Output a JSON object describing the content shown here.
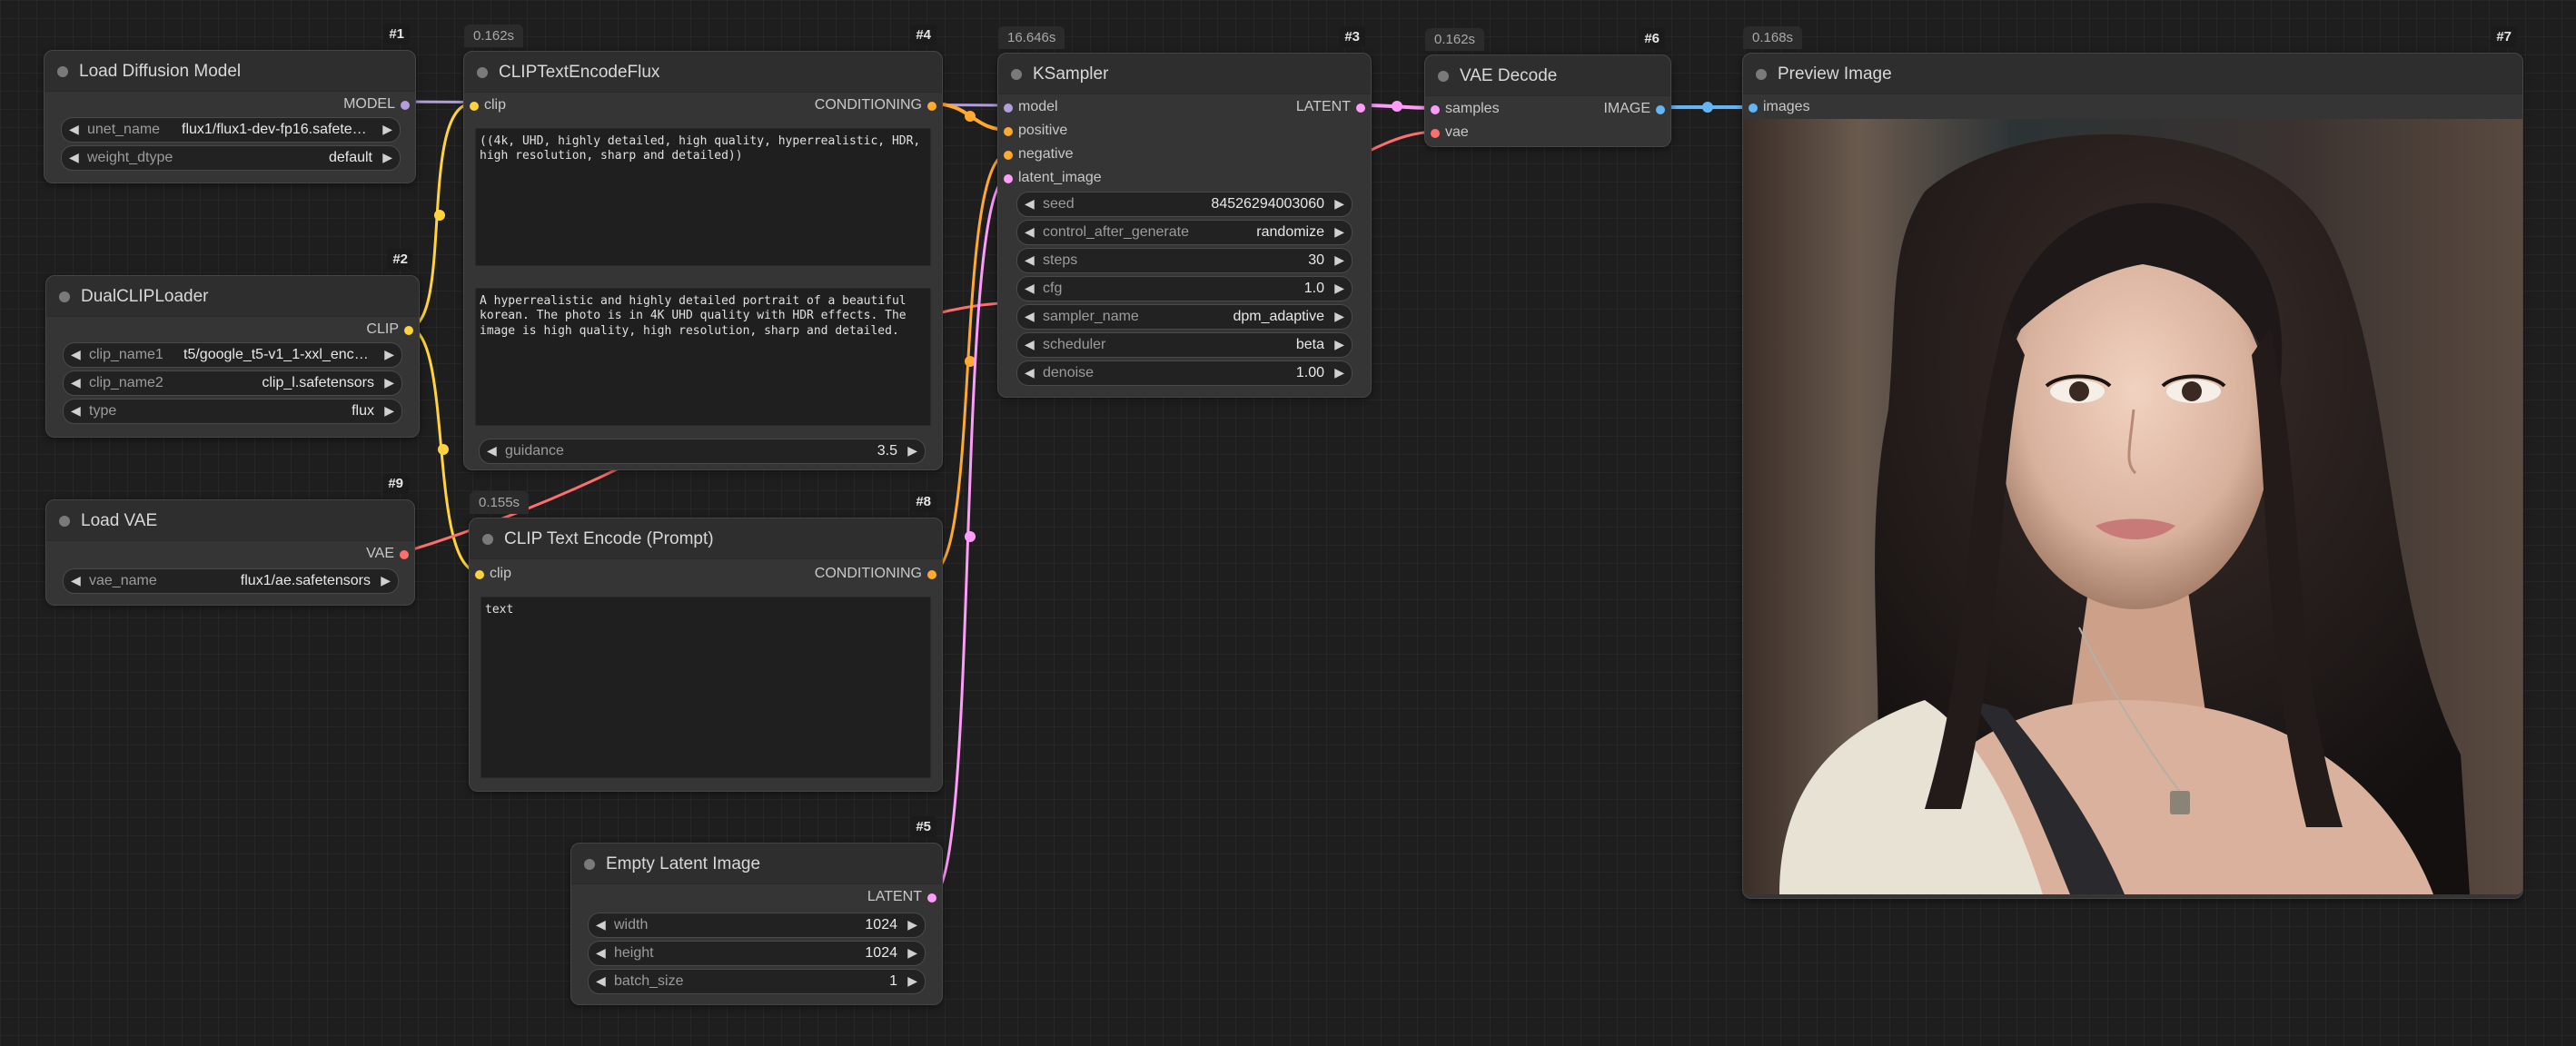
{
  "colors": {
    "model": "#b39ddb",
    "clip": "#ffd33d",
    "vae": "#ff6e6e",
    "conditioning": "#ffa931",
    "latent": "#ff9cf9",
    "image": "#64b5f6"
  },
  "nodes": {
    "n1": {
      "id": "#1",
      "title": "Load Diffusion Model",
      "out": "MODEL",
      "w_unet_label": "unet_name",
      "w_unet_val": "flux1/flux1-dev-fp16.safeten…",
      "w_dtype_label": "weight_dtype",
      "w_dtype_val": "default"
    },
    "n2": {
      "id": "#2",
      "title": "DualCLIPLoader",
      "out": "CLIP",
      "w_c1_label": "clip_name1",
      "w_c1_val": "t5/google_t5-v1_1-xxl_enco…",
      "w_c2_label": "clip_name2",
      "w_c2_val": "clip_l.safetensors",
      "w_type_label": "type",
      "w_type_val": "flux"
    },
    "n9": {
      "id": "#9",
      "title": "Load VAE",
      "out": "VAE",
      "w_vae_label": "vae_name",
      "w_vae_val": "flux1/ae.safetensors"
    },
    "n4": {
      "id": "#4",
      "time": "0.162s",
      "title": "CLIPTextEncodeFlux",
      "in": "clip",
      "out": "CONDITIONING",
      "text1": "((4k, UHD, highly detailed, high quality, hyperrealistic, HDR,\nhigh resolution, sharp and detailed))",
      "text2": "A hyperrealistic and highly detailed portrait of a beautiful\nkorean. The photo is in 4K UHD quality with HDR effects. The\nimage is high quality, high resolution, sharp and detailed.",
      "w_guid_label": "guidance",
      "w_guid_val": "3.5"
    },
    "n8": {
      "id": "#8",
      "time": "0.155s",
      "title": "CLIP Text Encode (Prompt)",
      "in": "clip",
      "out": "CONDITIONING",
      "text": "text"
    },
    "n5": {
      "id": "#5",
      "title": "Empty Latent Image",
      "out": "LATENT",
      "w_width_label": "width",
      "w_width_val": "1024",
      "w_height_label": "height",
      "w_height_val": "1024",
      "w_batch_label": "batch_size",
      "w_batch_val": "1"
    },
    "n3": {
      "id": "#3",
      "time": "16.646s",
      "title": "KSampler",
      "in_model": "model",
      "in_pos": "positive",
      "in_neg": "negative",
      "in_latent": "latent_image",
      "out": "LATENT",
      "w_seed_label": "seed",
      "w_seed_val": "84526294003060",
      "w_cag_label": "control_after_generate",
      "w_cag_val": "randomize",
      "w_steps_label": "steps",
      "w_steps_val": "30",
      "w_cfg_label": "cfg",
      "w_cfg_val": "1.0",
      "w_sampler_label": "sampler_name",
      "w_sampler_val": "dpm_adaptive",
      "w_sched_label": "scheduler",
      "w_sched_val": "beta",
      "w_denoise_label": "denoise",
      "w_denoise_val": "1.00"
    },
    "n6": {
      "id": "#6",
      "time": "0.162s",
      "title": "VAE Decode",
      "in_samples": "samples",
      "in_vae": "vae",
      "out": "IMAGE"
    },
    "n7": {
      "id": "#7",
      "time": "0.168s",
      "title": "Preview Image",
      "in": "images"
    }
  }
}
